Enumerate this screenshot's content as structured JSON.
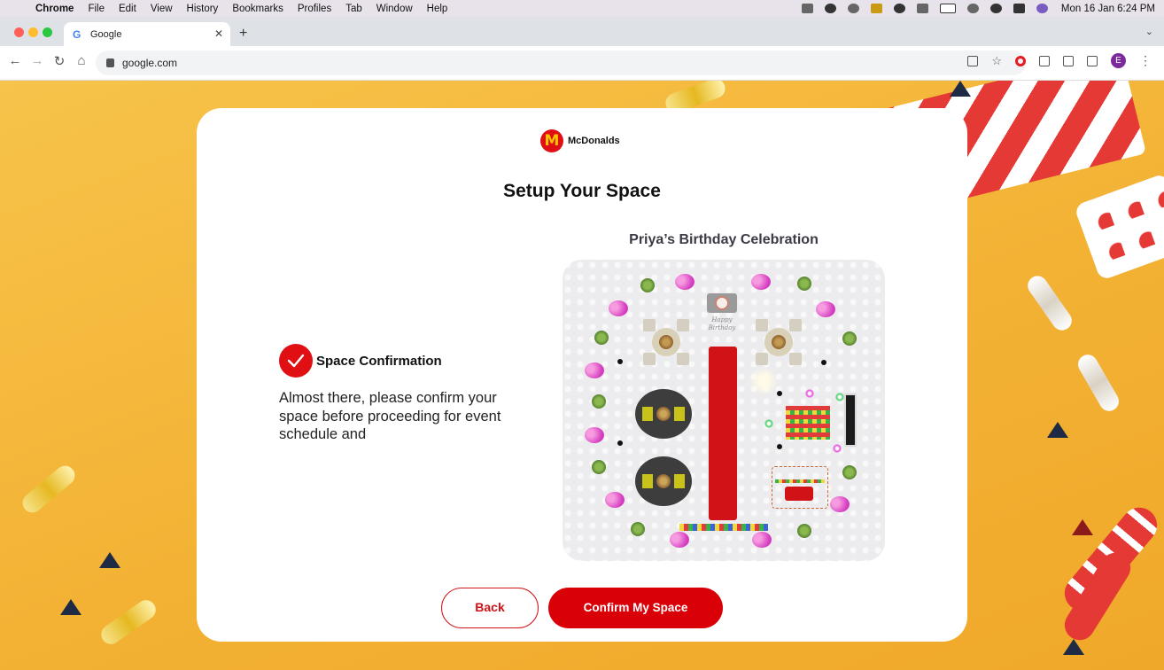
{
  "menubar": {
    "app": "Chrome",
    "items": [
      "File",
      "Edit",
      "View",
      "History",
      "Bookmarks",
      "Profiles",
      "Tab",
      "Window",
      "Help"
    ],
    "clock": "Mon 16 Jan  6:24 PM"
  },
  "browser": {
    "tab_title": "Google",
    "tab_favicon": "G",
    "new_tab": "+",
    "url": "google.com",
    "profile_initial": "E"
  },
  "card": {
    "brand": "McDonalds",
    "logo_glyph": "M",
    "title": "Setup Your Space",
    "step": {
      "title": "Space Confirmation",
      "description": "Almost there, please confirm your space before proceeding for event schedule and"
    },
    "event_title": "Priya’s Birthday Celebration",
    "cake_sign": "Happy Birthday",
    "buttons": {
      "back": "Back",
      "confirm": "Confirm My Space"
    }
  },
  "colors": {
    "accent": "#d90007",
    "background": "#f4b942",
    "card": "#ffffff"
  }
}
